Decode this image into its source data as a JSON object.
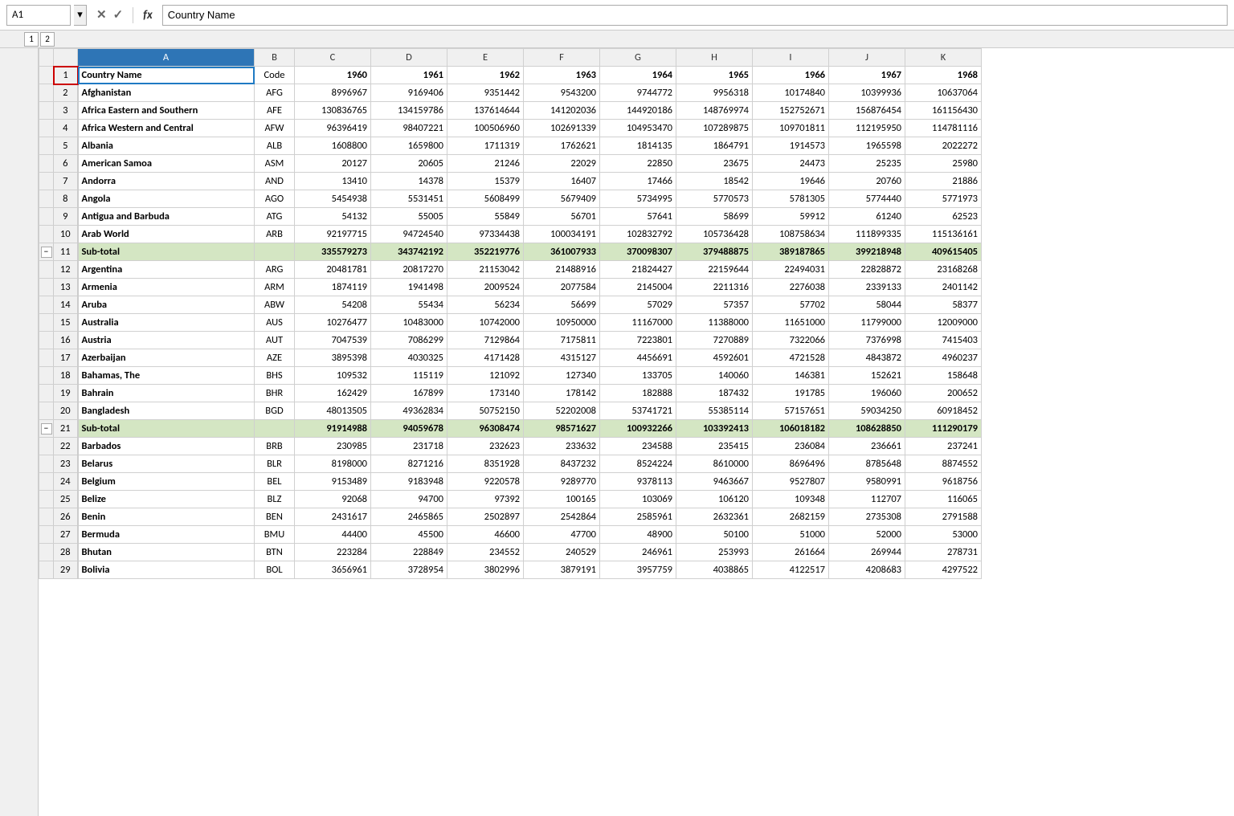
{
  "formulaBar": {
    "cellRef": "A1",
    "formulaText": "Country Name",
    "xLabel": "✕",
    "checkLabel": "✓",
    "fxLabel": "fx"
  },
  "groupLevels": [
    "1",
    "2"
  ],
  "columns": {
    "headers": [
      "",
      "A",
      "B",
      "C",
      "D",
      "E",
      "F",
      "G",
      "H",
      "I",
      "J",
      "K"
    ],
    "labels": [
      "",
      "Country Name",
      "Code",
      "1960",
      "1961",
      "1962",
      "1963",
      "1964",
      "1965",
      "1966",
      "1967",
      "1968"
    ]
  },
  "rows": [
    {
      "num": 1,
      "type": "header",
      "cells": [
        "Country Name",
        "Code",
        "1960",
        "1961",
        "1962",
        "1963",
        "1964",
        "1965",
        "1966",
        "1967",
        "1968"
      ]
    },
    {
      "num": 2,
      "type": "data",
      "cells": [
        "Afghanistan",
        "AFG",
        "8996967",
        "9169406",
        "9351442",
        "9543200",
        "9744772",
        "9956318",
        "10174840",
        "10399936",
        "10637064"
      ]
    },
    {
      "num": 3,
      "type": "data",
      "cells": [
        "Africa Eastern and Southern",
        "AFE",
        "130836765",
        "134159786",
        "137614644",
        "141202036",
        "144920186",
        "148769974",
        "152752671",
        "156876454",
        "161156430"
      ]
    },
    {
      "num": 4,
      "type": "data",
      "cells": [
        "Africa Western and Central",
        "AFW",
        "96396419",
        "98407221",
        "100506960",
        "102691339",
        "104953470",
        "107289875",
        "109701811",
        "112195950",
        "114781116"
      ]
    },
    {
      "num": 5,
      "type": "data",
      "cells": [
        "Albania",
        "ALB",
        "1608800",
        "1659800",
        "1711319",
        "1762621",
        "1814135",
        "1864791",
        "1914573",
        "1965598",
        "2022272"
      ]
    },
    {
      "num": 6,
      "type": "data",
      "cells": [
        "American Samoa",
        "ASM",
        "20127",
        "20605",
        "21246",
        "22029",
        "22850",
        "23675",
        "24473",
        "25235",
        "25980"
      ]
    },
    {
      "num": 7,
      "type": "data",
      "cells": [
        "Andorra",
        "AND",
        "13410",
        "14378",
        "15379",
        "16407",
        "17466",
        "18542",
        "19646",
        "20760",
        "21886"
      ]
    },
    {
      "num": 8,
      "type": "data",
      "cells": [
        "Angola",
        "AGO",
        "5454938",
        "5531451",
        "5608499",
        "5679409",
        "5734995",
        "5770573",
        "5781305",
        "5774440",
        "5771973"
      ]
    },
    {
      "num": 9,
      "type": "data",
      "cells": [
        "Antigua and Barbuda",
        "ATG",
        "54132",
        "55005",
        "55849",
        "56701",
        "57641",
        "58699",
        "59912",
        "61240",
        "62523"
      ]
    },
    {
      "num": 10,
      "type": "data",
      "cells": [
        "Arab World",
        "ARB",
        "92197715",
        "94724540",
        "97334438",
        "100034191",
        "102832792",
        "105736428",
        "108758634",
        "111899335",
        "115136161"
      ]
    },
    {
      "num": 11,
      "type": "subtotal",
      "cells": [
        "Sub-total",
        "",
        "335579273",
        "343742192",
        "352219776",
        "361007933",
        "370098307",
        "379488875",
        "389187865",
        "399218948",
        "409615405"
      ]
    },
    {
      "num": 12,
      "type": "data",
      "cells": [
        "Argentina",
        "ARG",
        "20481781",
        "20817270",
        "21153042",
        "21488916",
        "21824427",
        "22159644",
        "22494031",
        "22828872",
        "23168268"
      ]
    },
    {
      "num": 13,
      "type": "data",
      "cells": [
        "Armenia",
        "ARM",
        "1874119",
        "1941498",
        "2009524",
        "2077584",
        "2145004",
        "2211316",
        "2276038",
        "2339133",
        "2401142"
      ]
    },
    {
      "num": 14,
      "type": "data",
      "cells": [
        "Aruba",
        "ABW",
        "54208",
        "55434",
        "56234",
        "56699",
        "57029",
        "57357",
        "57702",
        "58044",
        "58377"
      ]
    },
    {
      "num": 15,
      "type": "data",
      "cells": [
        "Australia",
        "AUS",
        "10276477",
        "10483000",
        "10742000",
        "10950000",
        "11167000",
        "11388000",
        "11651000",
        "11799000",
        "12009000"
      ]
    },
    {
      "num": 16,
      "type": "data",
      "cells": [
        "Austria",
        "AUT",
        "7047539",
        "7086299",
        "7129864",
        "7175811",
        "7223801",
        "7270889",
        "7322066",
        "7376998",
        "7415403"
      ]
    },
    {
      "num": 17,
      "type": "data",
      "cells": [
        "Azerbaijan",
        "AZE",
        "3895398",
        "4030325",
        "4171428",
        "4315127",
        "4456691",
        "4592601",
        "4721528",
        "4843872",
        "4960237"
      ]
    },
    {
      "num": 18,
      "type": "data",
      "cells": [
        "Bahamas, The",
        "BHS",
        "109532",
        "115119",
        "121092",
        "127340",
        "133705",
        "140060",
        "146381",
        "152621",
        "158648"
      ]
    },
    {
      "num": 19,
      "type": "data",
      "cells": [
        "Bahrain",
        "BHR",
        "162429",
        "167899",
        "173140",
        "178142",
        "182888",
        "187432",
        "191785",
        "196060",
        "200652"
      ]
    },
    {
      "num": 20,
      "type": "data",
      "cells": [
        "Bangladesh",
        "BGD",
        "48013505",
        "49362834",
        "50752150",
        "52202008",
        "53741721",
        "55385114",
        "57157651",
        "59034250",
        "60918452"
      ]
    },
    {
      "num": 21,
      "type": "subtotal",
      "cells": [
        "Sub-total",
        "",
        "91914988",
        "94059678",
        "96308474",
        "98571627",
        "100932266",
        "103392413",
        "106018182",
        "108628850",
        "111290179"
      ]
    },
    {
      "num": 22,
      "type": "data",
      "cells": [
        "Barbados",
        "BRB",
        "230985",
        "231718",
        "232623",
        "233632",
        "234588",
        "235415",
        "236084",
        "236661",
        "237241"
      ]
    },
    {
      "num": 23,
      "type": "data",
      "cells": [
        "Belarus",
        "BLR",
        "8198000",
        "8271216",
        "8351928",
        "8437232",
        "8524224",
        "8610000",
        "8696496",
        "8785648",
        "8874552"
      ]
    },
    {
      "num": 24,
      "type": "data",
      "cells": [
        "Belgium",
        "BEL",
        "9153489",
        "9183948",
        "9220578",
        "9289770",
        "9378113",
        "9463667",
        "9527807",
        "9580991",
        "9618756"
      ]
    },
    {
      "num": 25,
      "type": "data",
      "cells": [
        "Belize",
        "BLZ",
        "92068",
        "94700",
        "97392",
        "100165",
        "103069",
        "106120",
        "109348",
        "112707",
        "116065"
      ]
    },
    {
      "num": 26,
      "type": "data",
      "cells": [
        "Benin",
        "BEN",
        "2431617",
        "2465865",
        "2502897",
        "2542864",
        "2585961",
        "2632361",
        "2682159",
        "2735308",
        "2791588"
      ]
    },
    {
      "num": 27,
      "type": "data",
      "cells": [
        "Bermuda",
        "BMU",
        "44400",
        "45500",
        "46600",
        "47700",
        "48900",
        "50100",
        "51000",
        "52000",
        "53000"
      ]
    },
    {
      "num": 28,
      "type": "data",
      "cells": [
        "Bhutan",
        "BTN",
        "223284",
        "228849",
        "234552",
        "240529",
        "246961",
        "253993",
        "261664",
        "269944",
        "278731"
      ]
    },
    {
      "num": 29,
      "type": "data",
      "cells": [
        "Bolivia",
        "BOL",
        "3656961",
        "3728954",
        "3802996",
        "3879191",
        "3957759",
        "4038865",
        "4122517",
        "4208683",
        "4297522"
      ]
    }
  ],
  "groupMinusRows": [
    11,
    21
  ],
  "colors": {
    "subtotalBg": "#d4e6c3",
    "headerBg": "#f0f0f0",
    "activeCellBorder": "#1f7ac3",
    "selectedColHeader": "#2e75b6",
    "gridLine": "#d0d0d0"
  }
}
